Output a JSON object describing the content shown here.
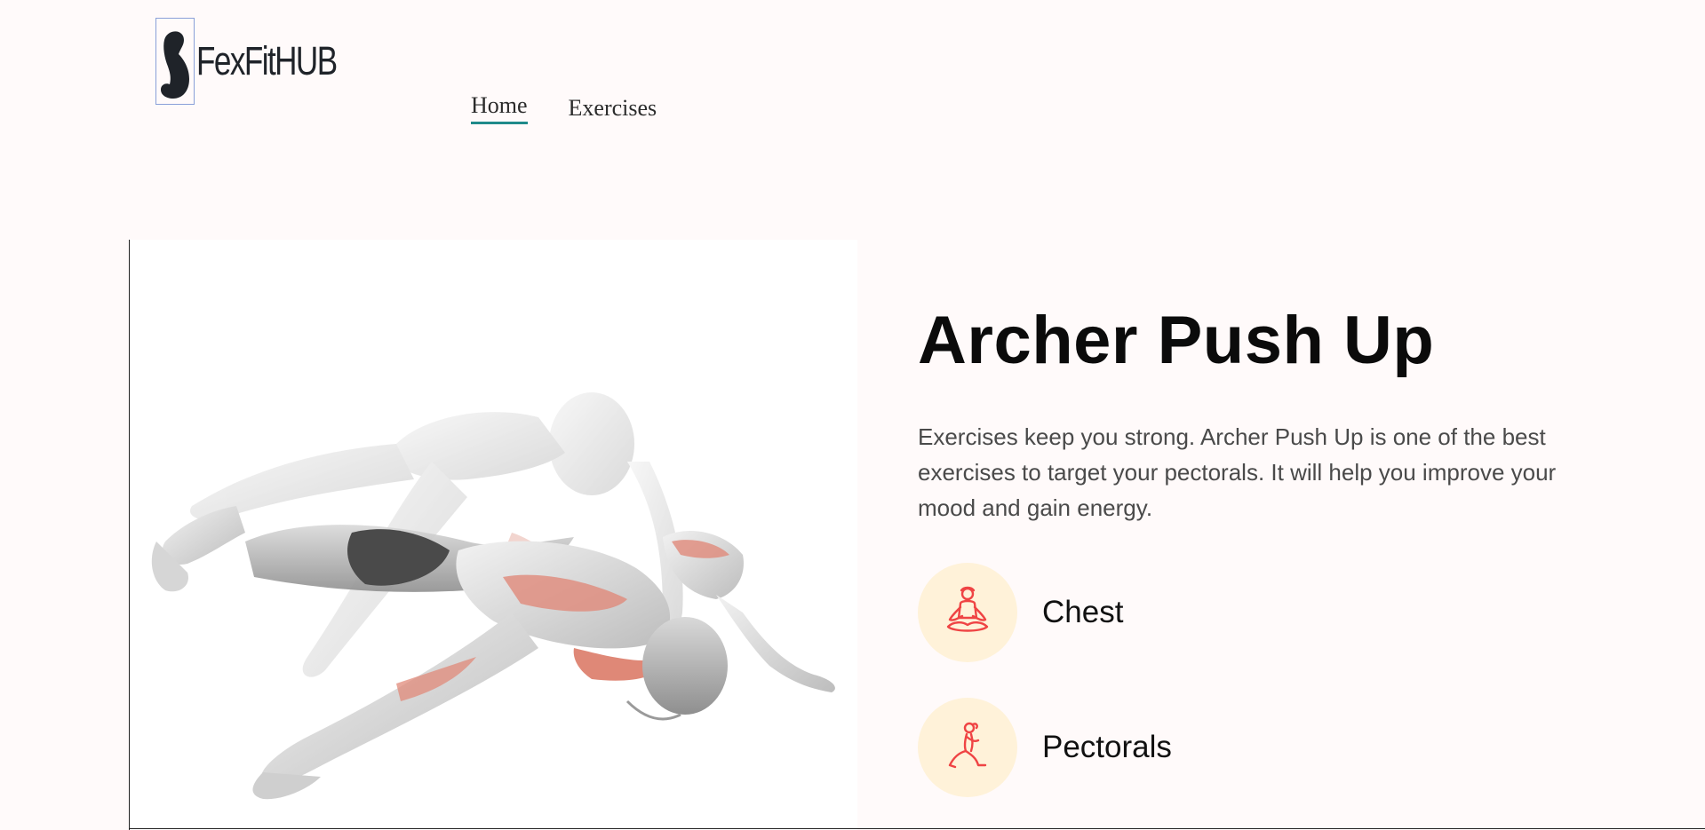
{
  "brand": {
    "name": "FexFitHUB"
  },
  "nav": {
    "items": [
      {
        "label": "Home",
        "active": true
      },
      {
        "label": "Exercises",
        "active": false
      }
    ]
  },
  "exercise": {
    "title": "Archer Push Up",
    "description": "Exercises keep you strong. Archer Push Up is one of the best exercises to target your pectorals. It will help you improve your mood and gain energy.",
    "image_icon": "archer-push-up-illustration",
    "tags": [
      {
        "label": "Chest",
        "icon": "meditation-pose-icon"
      },
      {
        "label": "Pectorals",
        "icon": "lunge-pose-icon"
      }
    ]
  },
  "colors": {
    "background": "#fffafa",
    "nav_underline": "#1f8a8a",
    "tag_circle": "#fff2d9",
    "tag_icon": "#ef4444",
    "muscle_highlight": "#e07a68"
  }
}
